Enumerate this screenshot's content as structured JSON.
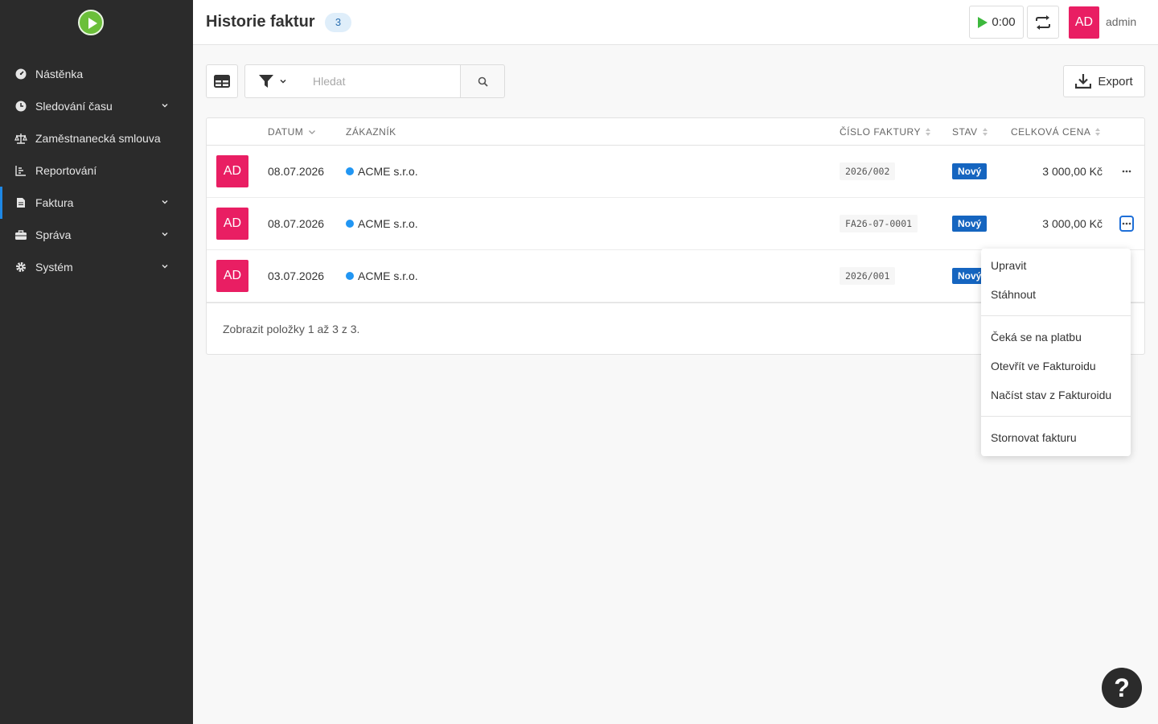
{
  "sidebar": {
    "items": [
      {
        "label": "Nástěnka",
        "icon": "dashboard-icon",
        "has_children": false
      },
      {
        "label": "Sledování času",
        "icon": "clock-icon",
        "has_children": true
      },
      {
        "label": "Zaměstnanecká smlouva",
        "icon": "scale-icon",
        "has_children": true
      },
      {
        "label": "Reportování",
        "icon": "chart-icon",
        "has_children": false
      },
      {
        "label": "Faktura",
        "icon": "file-icon",
        "has_children": true,
        "active": true
      },
      {
        "label": "Správa",
        "icon": "briefcase-icon",
        "has_children": true
      },
      {
        "label": "Systém",
        "icon": "gear-icon",
        "has_children": true
      }
    ]
  },
  "header": {
    "title": "Historie faktur",
    "count": "3",
    "timer": "0:00",
    "avatar_initials": "AD",
    "username": "admin"
  },
  "toolbar": {
    "search_placeholder": "Hledat",
    "export_label": "Export"
  },
  "table": {
    "columns": {
      "date": "DATUM",
      "customer": "ZÁKAZNÍK",
      "invoice_no": "ČÍSLO FAKTURY",
      "status": "STAV",
      "total": "CELKOVÁ CENA"
    },
    "rows": [
      {
        "avatar": "AD",
        "date": "08.07.2026",
        "customer": "ACME s.r.o.",
        "invoice_no": "2026/002",
        "status": "Nový",
        "total": "3 000,00 Kč"
      },
      {
        "avatar": "AD",
        "date": "08.07.2026",
        "customer": "ACME s.r.o.",
        "invoice_no": "FA26-07-0001",
        "status": "Nový",
        "total": "3 000,00 Kč"
      },
      {
        "avatar": "AD",
        "date": "03.07.2026",
        "customer": "ACME s.r.o.",
        "invoice_no": "2026/001",
        "status": "Nový",
        "total": ""
      }
    ],
    "footer": "Zobrazit položky 1 až 3 z 3."
  },
  "context_menu": {
    "items": [
      "Upravit",
      "Stáhnout",
      "Čeká se na platbu",
      "Otevřít ve Fakturoidu",
      "Načíst stav z Fakturoidu",
      "Stornovat fakturu"
    ]
  },
  "help": "?",
  "colors": {
    "sidebar_bg": "#2b2b2b",
    "accent": "#1e88e5",
    "avatar": "#e91e63",
    "status_badge": "#1565c0"
  }
}
